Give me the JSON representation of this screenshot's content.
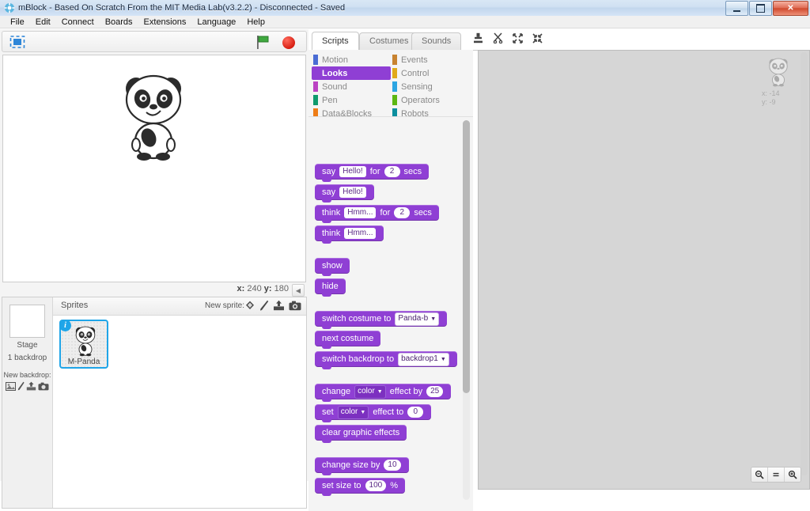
{
  "window": {
    "title": "mBlock - Based On Scratch From the MIT Media Lab(v3.2.2) - Disconnected - Saved",
    "app_icon": "mblock-logo-icon",
    "minimize_label": "Minimize",
    "maximize_label": "Maximize",
    "close_label": "Close"
  },
  "menubar": {
    "items": [
      {
        "label": "File"
      },
      {
        "label": "Edit"
      },
      {
        "label": "Connect"
      },
      {
        "label": "Boards"
      },
      {
        "label": "Extensions"
      },
      {
        "label": "Language"
      },
      {
        "label": "Help"
      }
    ]
  },
  "stage": {
    "presentation_icon": "fullscreen-icon",
    "green_flag_icon": "green-flag-icon",
    "stop_icon": "stop-button-icon",
    "sprite_name": "M-Panda",
    "mouse_x_label": "x:",
    "mouse_x": "240",
    "mouse_y_label": "y:",
    "mouse_y": "180",
    "collapse_icon": "collapse-left-icon"
  },
  "stage_selector": {
    "title": "Stage",
    "subtitle": "1 backdrop",
    "new_backdrop_label": "New backdrop:",
    "icons": [
      "library-picture-icon",
      "paint-brush-icon",
      "upload-icon",
      "camera-icon"
    ]
  },
  "sprites": {
    "header": "Sprites",
    "new_sprite_label": "New sprite:",
    "new_sprite_icons": [
      "library-picture-icon",
      "paint-brush-icon",
      "upload-icon",
      "camera-icon"
    ],
    "items": [
      {
        "name": "M-Panda",
        "selected": true,
        "info_badge": "i"
      }
    ]
  },
  "editor": {
    "tabs": [
      {
        "label": "Scripts",
        "active": true
      },
      {
        "label": "Costumes",
        "active": false
      },
      {
        "label": "Sounds",
        "active": false
      }
    ],
    "tools": [
      "stamp-duplicate-icon",
      "cut-scissors-icon",
      "grow-icon",
      "shrink-icon"
    ]
  },
  "palette": {
    "categories_left": [
      {
        "label": "Motion",
        "color": "#4a6cd4"
      },
      {
        "label": "Looks",
        "color": "#8f3fd4",
        "selected": true
      },
      {
        "label": "Sound",
        "color": "#bb42c3"
      },
      {
        "label": "Pen",
        "color": "#0e9a6c"
      },
      {
        "label": "Data&Blocks",
        "color": "#ee7d16"
      }
    ],
    "categories_right": [
      {
        "label": "Events",
        "color": "#c88330"
      },
      {
        "label": "Control",
        "color": "#e1a91a"
      },
      {
        "label": "Sensing",
        "color": "#2ca5e2"
      },
      {
        "label": "Operators",
        "color": "#5cb712"
      },
      {
        "label": "Robots",
        "color": "#0b8e9e"
      }
    ],
    "blocks": [
      {
        "id": "say-for-secs",
        "parts": [
          {
            "t": "txt",
            "v": "say"
          },
          {
            "t": "text",
            "v": "Hello!"
          },
          {
            "t": "txt",
            "v": "for"
          },
          {
            "t": "num",
            "v": "2"
          },
          {
            "t": "txt",
            "v": "secs"
          }
        ]
      },
      {
        "id": "say",
        "parts": [
          {
            "t": "txt",
            "v": "say"
          },
          {
            "t": "text",
            "v": "Hello!"
          }
        ]
      },
      {
        "id": "think-for-secs",
        "parts": [
          {
            "t": "txt",
            "v": "think"
          },
          {
            "t": "text",
            "v": "Hmm..."
          },
          {
            "t": "txt",
            "v": "for"
          },
          {
            "t": "num",
            "v": "2"
          },
          {
            "t": "txt",
            "v": "secs"
          }
        ]
      },
      {
        "id": "think",
        "parts": [
          {
            "t": "txt",
            "v": "think"
          },
          {
            "t": "text",
            "v": "Hmm..."
          }
        ]
      },
      {
        "id": "show",
        "parts": [
          {
            "t": "txt",
            "v": "show"
          }
        ]
      },
      {
        "id": "hide",
        "parts": [
          {
            "t": "txt",
            "v": "hide"
          }
        ]
      },
      {
        "id": "switch-costume",
        "parts": [
          {
            "t": "txt",
            "v": "switch costume to"
          },
          {
            "t": "drop-light",
            "v": "Panda-b"
          }
        ]
      },
      {
        "id": "next-costume",
        "parts": [
          {
            "t": "txt",
            "v": "next costume"
          }
        ]
      },
      {
        "id": "switch-backdrop",
        "parts": [
          {
            "t": "txt",
            "v": "switch backdrop to"
          },
          {
            "t": "drop-light",
            "v": "backdrop1"
          }
        ]
      },
      {
        "id": "change-effect",
        "parts": [
          {
            "t": "txt",
            "v": "change"
          },
          {
            "t": "drop",
            "v": "color"
          },
          {
            "t": "txt",
            "v": "effect by"
          },
          {
            "t": "num",
            "v": "25"
          }
        ]
      },
      {
        "id": "set-effect",
        "parts": [
          {
            "t": "txt",
            "v": "set"
          },
          {
            "t": "drop",
            "v": "color"
          },
          {
            "t": "txt",
            "v": "effect to"
          },
          {
            "t": "num",
            "v": "0"
          }
        ]
      },
      {
        "id": "clear-graphic-effects",
        "parts": [
          {
            "t": "txt",
            "v": "clear graphic effects"
          }
        ]
      },
      {
        "id": "change-size-by",
        "parts": [
          {
            "t": "txt",
            "v": "change size by"
          },
          {
            "t": "num",
            "v": "10"
          }
        ]
      },
      {
        "id": "set-size-to",
        "parts": [
          {
            "t": "txt",
            "v": "set size to"
          },
          {
            "t": "num",
            "v": "100"
          },
          {
            "t": "txt",
            "v": "%"
          }
        ]
      }
    ]
  },
  "canvas": {
    "watermark_sprite": "M-Panda",
    "watermark_x_label": "x:",
    "watermark_x": "-14",
    "watermark_y_label": "y:",
    "watermark_y": "-9",
    "zoom_out_icon": "zoom-out-icon",
    "zoom_reset_icon": "zoom-reset-icon",
    "zoom_in_icon": "zoom-in-icon"
  }
}
